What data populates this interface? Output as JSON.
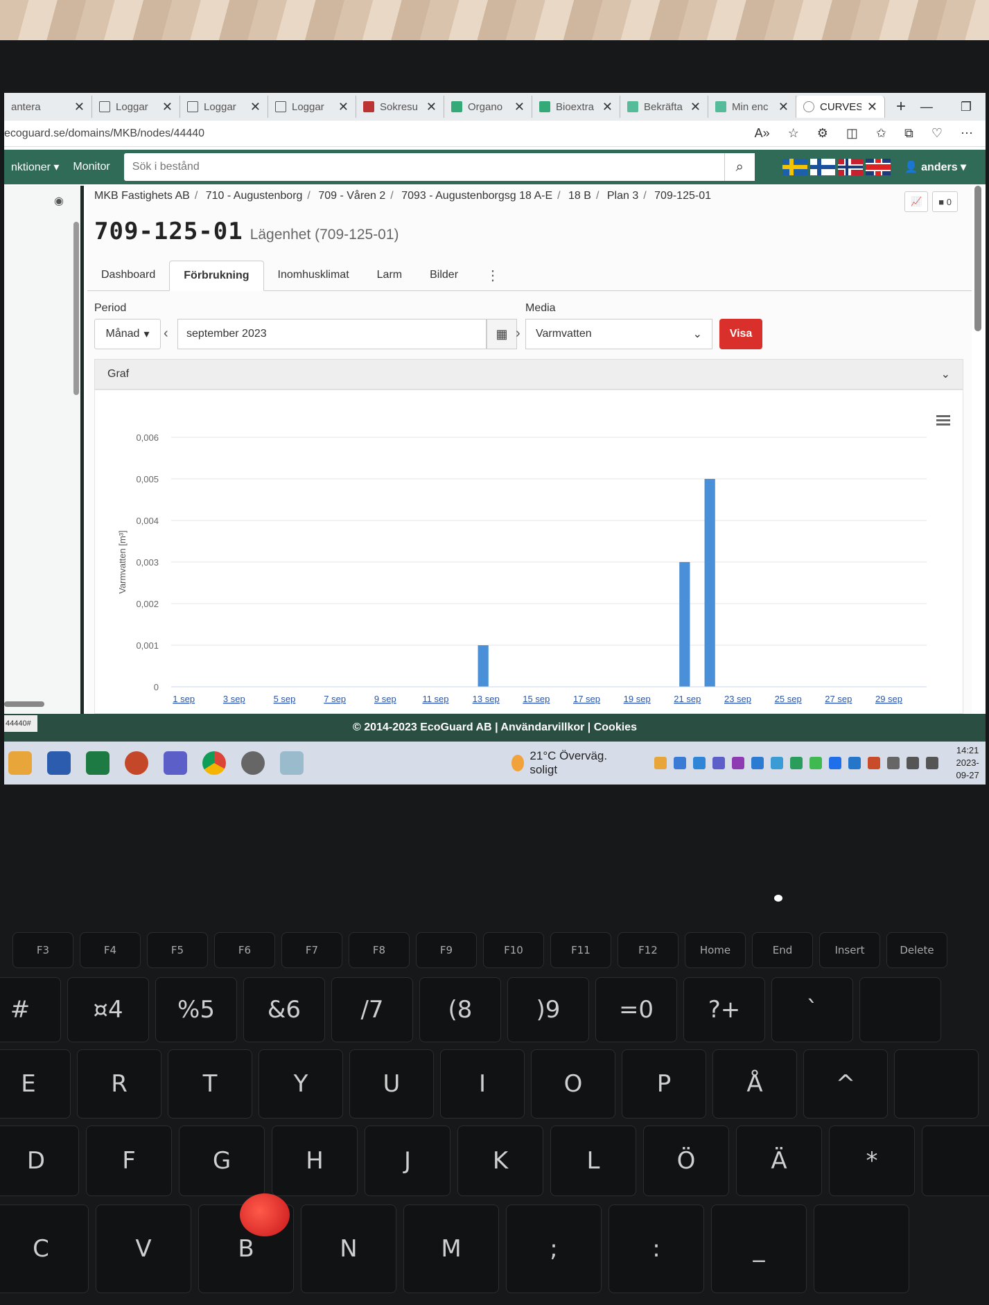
{
  "browser": {
    "tabs": [
      {
        "label": "antera",
        "icon": "page-icon"
      },
      {
        "label": "Loggar",
        "icon": "page-icon"
      },
      {
        "label": "Loggar",
        "icon": "page-icon"
      },
      {
        "label": "Loggar",
        "icon": "page-icon"
      },
      {
        "label": "Sokresu",
        "icon": "s-icon"
      },
      {
        "label": "Organo",
        "icon": "inv-icon"
      },
      {
        "label": "Bioextra",
        "icon": "inv-icon"
      },
      {
        "label": "Bekräfta",
        "icon": "green-icon"
      },
      {
        "label": "Min enc",
        "icon": "plant-icon"
      },
      {
        "label": "CURVES",
        "icon": "curves-icon"
      }
    ],
    "url": "ecoguard.se/domains/MKB/nodes/44440"
  },
  "navbar": {
    "menu_label": "nktioner",
    "monitor_label": "Monitor",
    "search_placeholder": "Sök i bestånd",
    "user": "anders",
    "flags": [
      "sweden-flag",
      "finland-flag",
      "norway-flag",
      "uk-flag"
    ]
  },
  "breadcrumb": [
    "MKB Fastighets AB",
    "710 - Augustenborg",
    "709 - Våren 2",
    "7093 - Augustenborgsg 18 A-E",
    "18 B",
    "Plan 3",
    "709-125-01"
  ],
  "header": {
    "title": "709-125-01",
    "subtitle": "Lägenhet (709-125-01)",
    "comment_count": "0"
  },
  "page_tabs": [
    "Dashboard",
    "Förbrukning",
    "Inomhusklimat",
    "Larm",
    "Bilder"
  ],
  "filters": {
    "period_label": "Period",
    "period_type": "Månad",
    "date_value": "september 2023",
    "media_label": "Media",
    "media_value": "Varmvatten",
    "show_button": "Visa"
  },
  "graph_section_label": "Graf",
  "chart_data": {
    "type": "bar",
    "ylabel": "Varmvatten [m³]",
    "ylim": [
      0,
      0.006
    ],
    "yticks": [
      "0",
      "0,001",
      "0,002",
      "0,003",
      "0,004",
      "0,005",
      "0,006"
    ],
    "x_tick_labels": [
      "1 sep",
      "3 sep",
      "5 sep",
      "7 sep",
      "9 sep",
      "11 sep",
      "13 sep",
      "15 sep",
      "17 sep",
      "19 sep",
      "21 sep",
      "23 sep",
      "25 sep",
      "27 sep",
      "29 sep"
    ],
    "categories": [
      "1",
      "2",
      "3",
      "4",
      "5",
      "6",
      "7",
      "8",
      "9",
      "10",
      "11",
      "12",
      "13",
      "14",
      "15",
      "16",
      "17",
      "18",
      "19",
      "20",
      "21",
      "22",
      "23",
      "24",
      "25",
      "26",
      "27",
      "28",
      "29",
      "30"
    ],
    "series": [
      {
        "name": "september 2023",
        "color": "#4a90d9",
        "values": [
          0,
          0,
          0,
          0,
          0,
          0,
          0,
          0,
          0,
          0,
          0,
          0,
          0.001,
          0,
          0,
          0,
          0,
          0,
          0,
          0,
          0.003,
          0.005,
          0,
          0,
          0,
          0,
          0,
          0,
          0,
          0
        ]
      }
    ],
    "grid": true,
    "legend": "bottom"
  },
  "footer": "© 2014-2023 EcoGuard AB | Användarvillkor | Cookies",
  "status_link": "44440#",
  "taskbar": {
    "weather": "21°C  Överväg. soligt",
    "time": "14:21",
    "date": "2023-09-27"
  },
  "keyboard": {
    "fn_keys": [
      "F3",
      "F4",
      "F5",
      "F6",
      "F7",
      "F8",
      "F9",
      "F10",
      "F11",
      "F12",
      "Home",
      "End",
      "Insert",
      "Delete"
    ],
    "number_row": [
      "#",
      "¤4",
      "%5",
      "&6",
      "/7",
      "(8",
      ")9",
      "=0",
      "?+",
      "`",
      ""
    ],
    "top_row": [
      "E",
      "R",
      "T",
      "Y",
      "U",
      "I",
      "O",
      "P",
      "Å",
      "^",
      ""
    ],
    "home_row": [
      "D",
      "F",
      "G",
      "H",
      "J",
      "K",
      "L",
      "Ö",
      "Ä",
      "*",
      ""
    ],
    "bottom_row": [
      "C",
      "V",
      "B",
      "N",
      "M",
      ";",
      ":",
      "_",
      ""
    ]
  },
  "colors": {
    "navbar": "#2f6b57",
    "visa": "#d9302b",
    "bar": "#4a90d9",
    "footer": "#2b4e43"
  }
}
